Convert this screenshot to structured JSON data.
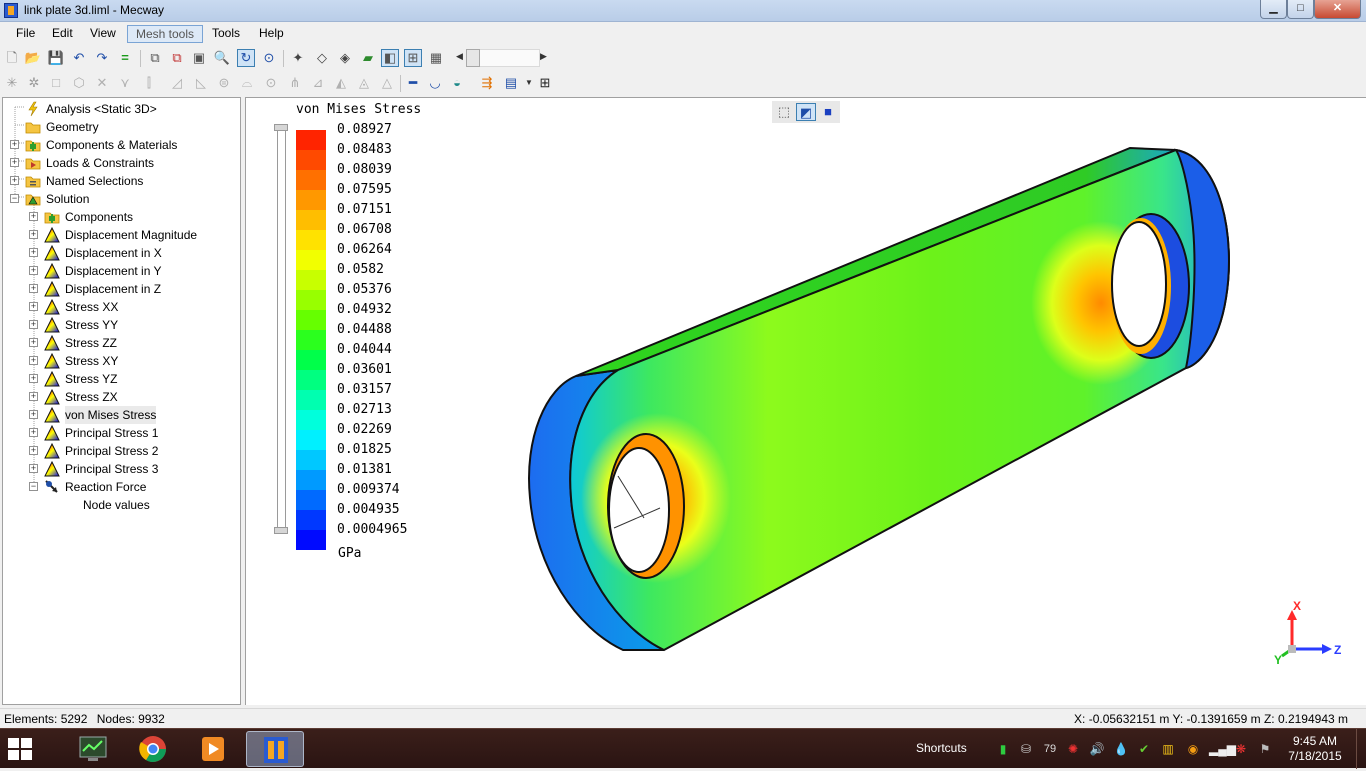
{
  "window": {
    "title": "link plate 3d.liml - Mecway",
    "controls": {
      "minimize": "▁",
      "maximize": "□",
      "close": "✕"
    }
  },
  "menu": {
    "file": "File",
    "edit": "Edit",
    "view": "View",
    "mesh_tools": "Mesh tools",
    "tools": "Tools",
    "help": "Help"
  },
  "tree": {
    "analysis": "Analysis <Static 3D>",
    "geometry": "Geometry",
    "components_materials": "Components & Materials",
    "loads_constraints": "Loads & Constraints",
    "named_selections": "Named Selections",
    "solution": "Solution",
    "solution_items": [
      "Components",
      "Displacement Magnitude",
      "Displacement in X",
      "Displacement in Y",
      "Displacement in Z",
      "Stress XX",
      "Stress YY",
      "Stress ZZ",
      "Stress XY",
      "Stress YZ",
      "Stress ZX",
      "von Mises Stress",
      "Principal Stress 1",
      "Principal Stress 2",
      "Principal Stress 3",
      "Reaction Force"
    ],
    "node_values": "Node values",
    "selected": "von Mises Stress"
  },
  "legend": {
    "title": "von Mises Stress",
    "unit": "GPa",
    "values": [
      "0.08927",
      "0.08483",
      "0.08039",
      "0.07595",
      "0.07151",
      "0.06708",
      "0.06264",
      "0.0582",
      "0.05376",
      "0.04932",
      "0.04488",
      "0.04044",
      "0.03601",
      "0.03157",
      "0.02713",
      "0.02269",
      "0.01825",
      "0.01381",
      "0.009374",
      "0.004935",
      "0.0004965"
    ],
    "colors": [
      "#ff2400",
      "#ff4a00",
      "#ff7000",
      "#ff9800",
      "#ffbe00",
      "#ffe200",
      "#f2ff00",
      "#c8ff00",
      "#98ff00",
      "#66ff00",
      "#2bff1e",
      "#00ff4a",
      "#00ff80",
      "#00ffb0",
      "#00ffdc",
      "#00f0ff",
      "#00c8ff",
      "#009aff",
      "#006aff",
      "#0038ff",
      "#000aff"
    ]
  },
  "axes": {
    "x": "X",
    "y": "Y",
    "z": "Z"
  },
  "status": {
    "elements_label": "Elements:",
    "elements": "5292",
    "nodes_label": "Nodes:",
    "nodes": "9932",
    "coords": "X: -0.05632151 m Y: -0.1391659 m Z: 0.2194943 m"
  },
  "taskbar": {
    "shortcuts": "Shortcuts",
    "tray_number": "79",
    "time": "9:45 AM",
    "date": "7/18/2015"
  }
}
